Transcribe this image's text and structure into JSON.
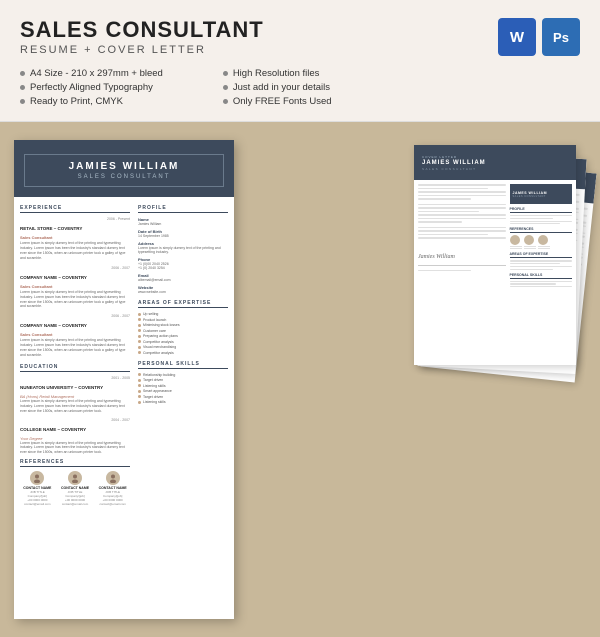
{
  "header": {
    "title": "SALES CONSULTANT",
    "subtitle": "RESUME + COVER LETTER",
    "word_icon": "W",
    "ps_icon": "Ps",
    "features_left": [
      "A4 Size - 210 x 297mm + bleed",
      "Perfectly Aligned Typography",
      "Ready to Print, CMYK"
    ],
    "features_right": [
      "High Resolution files",
      "Just add in your details",
      "Only FREE Fonts Used"
    ]
  },
  "resume": {
    "name": "JAMIES WILLIAM",
    "role": "SALES CONSULTANT",
    "sections": {
      "experience": {
        "label": "EXPERIENCE",
        "jobs": [
          {
            "company": "RETAIL STORE – COVENTRY",
            "title": "Sales Consultant",
            "date": "2006 - Present",
            "desc": "Lorem ipsum is simply dummy text of the printing and typesetting industry. Lorem ipsum has been the industry's standard dummy text ever since the 1500s, when an unknown printer took a galley of type and scramble."
          },
          {
            "company": "COMPANY NAME – COVENTRY",
            "title": "Sales Consultant",
            "date": "2006 - 2007",
            "desc": "Lorem ipsum is simply dummy text of the printing and typesetting industry. Lorem ipsum has been the industry's standard dummy text ever since the 1500s, when an unknown printer took a galley of type and scramble."
          },
          {
            "company": "COMPANY NAME – COVENTRY",
            "title": "Sales Consultant",
            "date": "2006 - 2007",
            "desc": "Lorem ipsum is simply dummy text of the printing and typesetting industry. Lorem ipsum has been the industry's standard dummy text ever since the 1500s, when an unknown printer took a galley of type and scramble."
          }
        ]
      },
      "education": {
        "label": "EDUCATION",
        "entries": [
          {
            "name": "NUNEATON UNIVERSITY – COVENTRY",
            "degree": "BA (Hons) Retail Management",
            "date": "2001 - 2005",
            "desc": "Lorem ipsum is simply dummy text of the printing and typesetting industry. Lorem ipsum has been the industry's standard dummy text ever since the 1500s, when an unknown printer took."
          },
          {
            "name": "COLLEGE NAME – COVENTRY",
            "degree": "Your Degree",
            "date": "2004 - 2007",
            "desc": "Lorem ipsum is simply dummy text of the printing and typesetting industry. Lorem ipsum has been the industry's standard dummy text ever since the 1500s, when an unknown printer took."
          }
        ]
      },
      "references": {
        "label": "REFERENCES",
        "contacts": [
          {
            "name": "CONTACT NAME",
            "title": "JOB TITLE",
            "info": "Company/[job]\n+00 (0)00 0000 0000\ncontact@email.com"
          },
          {
            "name": "CONTACT NAME",
            "title": "JOB TITLE",
            "info": "Company/[job]\n+00 (0)00 0000 0000\ncontact@email.com"
          },
          {
            "name": "CONTACT NAME",
            "title": "JOB TITLE",
            "info": "Company/[job]\n+00 (0)00 0000 0000\ncontact@email.com"
          }
        ]
      }
    },
    "profile": {
      "label": "PROFILE",
      "fields": [
        {
          "name": "Name",
          "value": "Jamies William"
        },
        {
          "name": "Date of Birth",
          "value": "14 September 1985"
        },
        {
          "name": "Address",
          "value": "Lorem ipsum is simply dummy text of the printing and typesetting industry."
        },
        {
          "name": "Phone",
          "value": "+1 (0)00 2040 2526\n+1 (0) 2040 3254"
        },
        {
          "name": "Email",
          "value": "albemail@email.com"
        },
        {
          "name": "Website",
          "value": "www.website.com"
        }
      ]
    },
    "expertise": {
      "label": "AREAS OF EXPERTISE",
      "items": [
        "Up selling",
        "Product launch",
        "Minimising stock losses",
        "Customer care",
        "Preparing action plans",
        "Competitor analysis",
        "Visual merchandising",
        "Competitor analysis"
      ]
    },
    "personal": {
      "label": "PERSONAL SKILLS",
      "items": [
        "Relationship building",
        "Target driven",
        "Listening skills",
        "Smart appearance",
        "Target driven",
        "Listening skills"
      ]
    }
  }
}
